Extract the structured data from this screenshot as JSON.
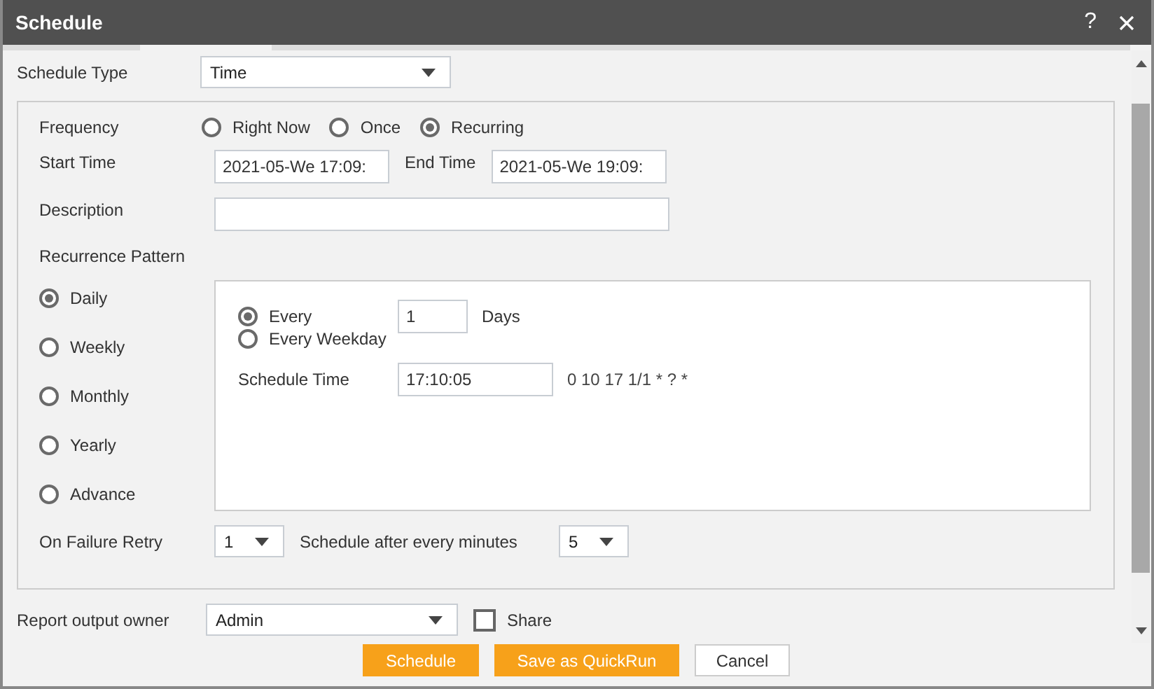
{
  "window": {
    "title": "Schedule",
    "help": "?"
  },
  "schedule_type": {
    "label": "Schedule Type",
    "value": "Time"
  },
  "frequency": {
    "label": "Frequency",
    "options": [
      {
        "label": "Right Now",
        "selected": false
      },
      {
        "label": "Once",
        "selected": false
      },
      {
        "label": "Recurring",
        "selected": true
      }
    ]
  },
  "start_time": {
    "label": "Start Time",
    "value": "2021-05-We 17:09:"
  },
  "end_time": {
    "label": "End Time",
    "value": "2021-05-We 19:09:"
  },
  "description": {
    "label": "Description"
  },
  "recurrence": {
    "label": "Recurrence Pattern",
    "patterns": [
      {
        "label": "Daily",
        "selected": true
      },
      {
        "label": "Weekly",
        "selected": false
      },
      {
        "label": "Monthly",
        "selected": false
      },
      {
        "label": "Yearly",
        "selected": false
      },
      {
        "label": "Advance",
        "selected": false
      }
    ],
    "every": {
      "label": "Every",
      "selected": true,
      "value": "1",
      "unit": "Days"
    },
    "every_weekday": {
      "label": "Every Weekday",
      "selected": false
    },
    "schedule_time": {
      "label": "Schedule Time",
      "value": "17:10:05",
      "cron": "0 10 17 1/1 * ? *"
    }
  },
  "retry": {
    "label": "On Failure Retry",
    "value": "1"
  },
  "interval": {
    "label": "Schedule after every minutes",
    "value": "5"
  },
  "owner": {
    "label": "Report output owner",
    "value": "Admin"
  },
  "share": {
    "label": "Share",
    "checked": false
  },
  "buttons": [
    {
      "label": "Schedule",
      "kind": "primary"
    },
    {
      "label": "Save as QuickRun",
      "kind": "primary"
    },
    {
      "label": "Cancel",
      "kind": "secondary"
    }
  ]
}
